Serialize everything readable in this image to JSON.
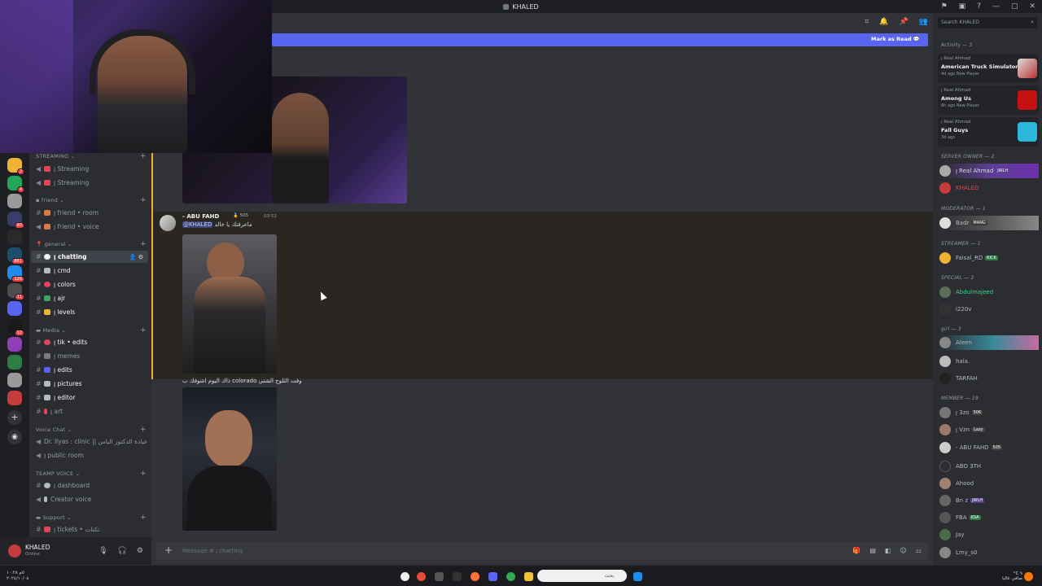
{
  "window": {
    "title": "KHALED"
  },
  "header": {
    "mark_as_read": "Mark as Read"
  },
  "search": {
    "placeholder": "Search KHALED"
  },
  "sidebar": {
    "categories": {
      "streaming": "STREAMING",
      "friend": "friend",
      "general": "general",
      "media": "Media",
      "voice_chat": "Voice Chat",
      "teamp_voice": "TEAMP VOICE",
      "support": "Support"
    },
    "channels": {
      "streaming1": "ꞁ Streaming",
      "streaming2": "ꞁ Streaming",
      "friend_room": "ꞁ friend • room",
      "friend_voice": "ꞁ friend • voice",
      "chatting": "ꞁ chatting",
      "cmd": "ꞁ cmd",
      "colors": "ꞁ colors",
      "ajr": "ꞁ ajr",
      "levels": "ꞁ levels",
      "tik_edits": "ꞁ tik • edits",
      "memes": "ꞁ memes",
      "edits": "ꞁ edits",
      "pictures": "ꞁ pictures",
      "editor": "ꞁ editor",
      "art": "ꞁ art",
      "dr_ilyas": "Dr. Ilyas : clinic || عيادة الدكتور الياس",
      "public_room": "ꞁ public room",
      "dashboard": "ꞁ dashboard",
      "creator_voice": "Creator voice",
      "tickets": "ꞁ tickets • تكتات"
    }
  },
  "user_panel": {
    "name": "KHALED",
    "status": "Online"
  },
  "message": {
    "author": "- ABU FAHD",
    "author_tag": "505",
    "time": "03:52",
    "mention": "@KHALED",
    "text": "ماعرفتك يا خالد",
    "caption": "ذاك اليوم اشوفك ب colorado وقت الثلوج الشتي"
  },
  "composer": {
    "placeholder": "Message # ꞁ chatting"
  },
  "members": {
    "activity_label": "Activity — 3",
    "activities": [
      {
        "who": "ꞁ Real Ahmad",
        "game": "American Truck Simulator",
        "meta": "4d ago  New Player"
      },
      {
        "who": "ꞁ Real Ahmad",
        "game": "Among Us",
        "meta": "6h ago  New Player"
      },
      {
        "who": "ꞁ Real Ahmad",
        "game": "Fall Guys",
        "meta": "3d ago"
      }
    ],
    "sections": {
      "server_owner": "SERVER OWNER — 2",
      "moderator": "MODERATOR — 1",
      "streamer": "STREAMER — 1",
      "special": "SPECIAL — 2",
      "girl": "girl — 3",
      "member": "MEMBER — 19"
    },
    "list": {
      "real_ahmad": "ꞁ Real Ahmad",
      "real_ahmad_tag": "JWLH",
      "khaled": "KHALED",
      "badr": "Badr",
      "badr_tag": "MANG",
      "faisal": "Faisal_RD",
      "faisal_tag": "KICK",
      "abdulmajeed": "Abdulmajeed",
      "i220v": "i220v",
      "aleen": "Aleen",
      "hala": "hala.",
      "tarfah": "TARFAH",
      "i3zo": "ꞁ 3zo",
      "i3zo_tag": "506",
      "vzn": "ꞁ Vzn",
      "vzn_tag": "Lazy",
      "abu_fahd": "- ABU FAHD",
      "abu_fahd_tag": "505",
      "abo3th": "ABO 3TH",
      "ahood": "Ahood",
      "bnz": "Bn z",
      "bnz_tag": "JWLH",
      "fba": "FBA",
      "fba_tag": "KSA",
      "jay": "Jay",
      "lmy": "Lmy_s0"
    }
  },
  "taskbar": {
    "search_placeholder": "بحث",
    "clock_line1": "٥م ١٠:٢٨",
    "clock_line2": "٢٠٢٤/١٠/٠٨",
    "tray_line1": "°C ٩",
    "tray_line2": "صافي غالبا"
  }
}
